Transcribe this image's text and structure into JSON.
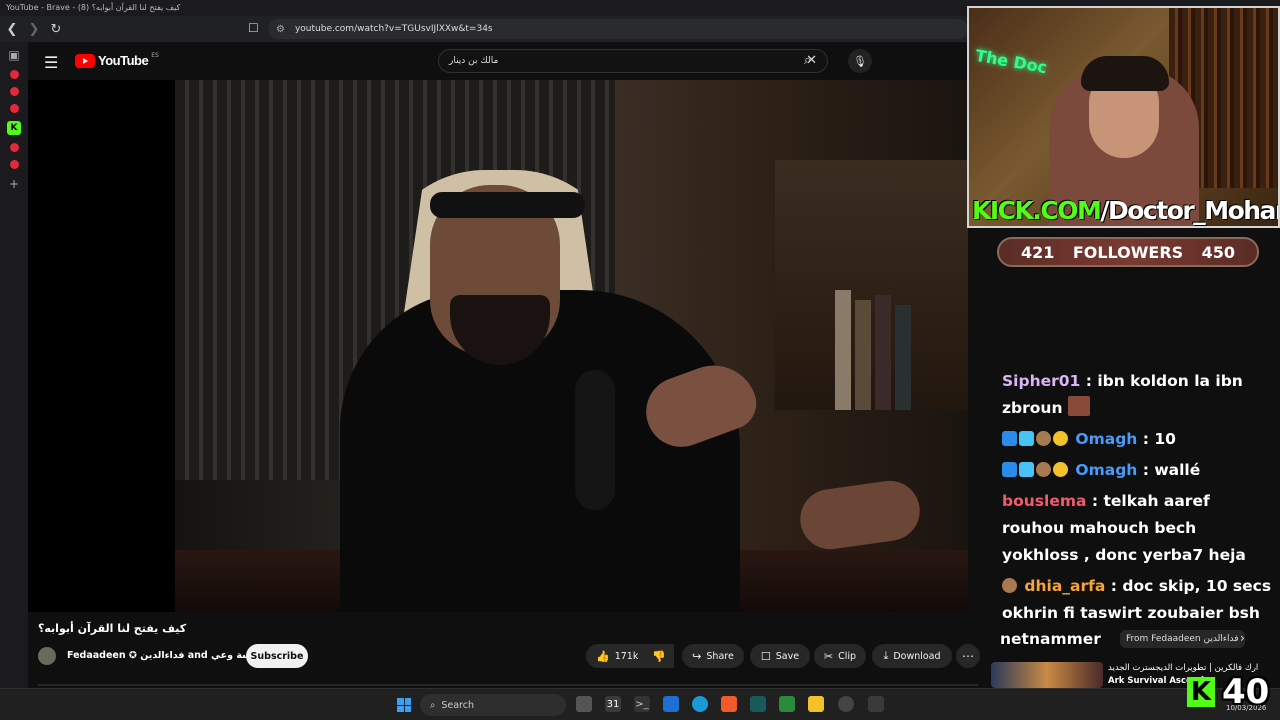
{
  "browser": {
    "window_title": "YouTube - Brave - (8) كيف يفتح لنا القرآن أبوابه؟",
    "url": "youtube.com/watch?v=TGUsvIJlXXw&t=34s"
  },
  "youtube": {
    "logo_text": "YouTube",
    "country_code": "ES",
    "search_value": "مالك بن دينار",
    "video_title": "كيف يفتح لنا القرآن أبوابه؟",
    "channel_name": "Fedaadeen ✪ فداءالدين and مؤسسة وعي",
    "subscribe_label": "Subscribe",
    "actions": {
      "likes": "171k",
      "share": "Share",
      "save": "Save",
      "clip": "Clip",
      "download": "Download"
    },
    "chips": [
      "From Fedaadeen فداءالدين"
    ],
    "reco_title": "ارك فالكرين | تطويرات الديجسترت الجديد",
    "reco_sub": "Ark Survival Ascend"
  },
  "stream": {
    "neon_sign": "The Doc",
    "kick_url_green": "KICK.COM",
    "kick_url_white": "/Doctor_Mohamed",
    "followers_current": "421",
    "followers_label": "FOLLOWERS",
    "followers_goal": "450",
    "viewers": "40",
    "chat": [
      {
        "user": "Sipher01",
        "text": ": ibn koldon la ibn zbroun"
      },
      {
        "user": "Omagh",
        "text": ": 10"
      },
      {
        "user": "Omagh",
        "text": ": wallé"
      },
      {
        "user": "bouslema",
        "text": ": telkah aaref rouhou mahouch bech yokhloss , donc yerba7 heja"
      },
      {
        "user": "dhia_arfa",
        "text": ": doc skip, 10 secs okhrin fi taswirt zoubaier bsh"
      },
      {
        "user": "netnammer",
        "text": ""
      }
    ]
  },
  "taskbar": {
    "search_placeholder": "Search",
    "date": "10/03/2026"
  },
  "colors": {
    "kick_green": "#53fc18",
    "yt_red": "#ff0000"
  }
}
